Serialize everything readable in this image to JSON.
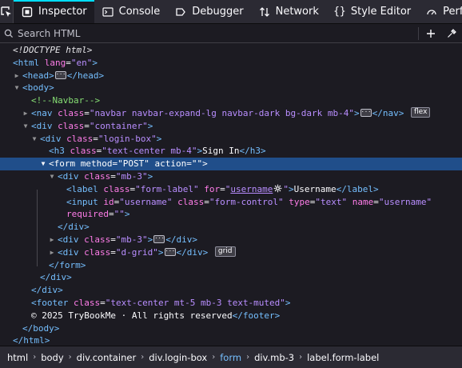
{
  "toolbar": {
    "tabs": [
      {
        "label": "Inspector",
        "icon": "inspector-icon"
      },
      {
        "label": "Console",
        "icon": "console-icon"
      },
      {
        "label": "Debugger",
        "icon": "debugger-icon"
      },
      {
        "label": "Network",
        "icon": "network-icon"
      },
      {
        "label": "Style Editor",
        "icon": "style-editor-icon"
      },
      {
        "label": "Performance",
        "icon": "performance-icon"
      }
    ],
    "active_tab": "Inspector",
    "accent_color": "#00ddff"
  },
  "search": {
    "placeholder": "Search HTML"
  },
  "tree": {
    "doctype": "<!DOCTYPE html>",
    "html_open": {
      "tag": "html",
      "attr": "lang",
      "value": "en"
    },
    "head": {
      "open": "<head>",
      "close": "</head>"
    },
    "body_tag": "body",
    "comment": "<!--Navbar-->",
    "nav": {
      "tag": "nav",
      "attr": "class",
      "value": "navbar navbar-expand-lg navbar-dark bg-dark mb-4",
      "badge": "flex"
    },
    "container": {
      "tag": "div",
      "attr": "class",
      "value": "container"
    },
    "login_box": {
      "tag": "div",
      "attr": "class",
      "value": "login-box"
    },
    "h3": {
      "tag": "h3",
      "attr": "class",
      "value": "text-center mb-4",
      "text": "Sign In"
    },
    "form": {
      "tag": "form",
      "attr1": "method",
      "value1": "POST",
      "attr2": "action",
      "value2": ""
    },
    "mb3": {
      "tag": "div",
      "attr": "class",
      "value": "mb-3"
    },
    "label": {
      "tag": "label",
      "attr1": "class",
      "value1": "form-label",
      "attr2": "for",
      "value2": "username",
      "text": "Username"
    },
    "input": {
      "tag": "input",
      "attr1": "id",
      "value1": "username",
      "attr2": "class",
      "value2": "form-control",
      "attr3": "type",
      "value3": "text",
      "attr4": "name",
      "value4": "username",
      "attr5": "required",
      "value5": ""
    },
    "mb3_collapsed": {
      "tag": "div",
      "attr": "class",
      "value": "mb-3"
    },
    "dgrid": {
      "tag": "div",
      "attr": "class",
      "value": "d-grid",
      "badge": "grid"
    },
    "footer": {
      "tag": "footer",
      "attr": "class",
      "value": "text-center mt-5 mb-3 text-muted",
      "text": "© 2025 TryBookMe · All rights reserved"
    }
  },
  "breadcrumbs": [
    {
      "label": "html",
      "current": false
    },
    {
      "label": "body",
      "current": false
    },
    {
      "label": "div.container",
      "current": false
    },
    {
      "label": "div.login-box",
      "current": false
    },
    {
      "label": "form",
      "current": true
    },
    {
      "label": "div.mb-3",
      "current": false
    },
    {
      "label": "label.form-label",
      "current": false
    }
  ]
}
